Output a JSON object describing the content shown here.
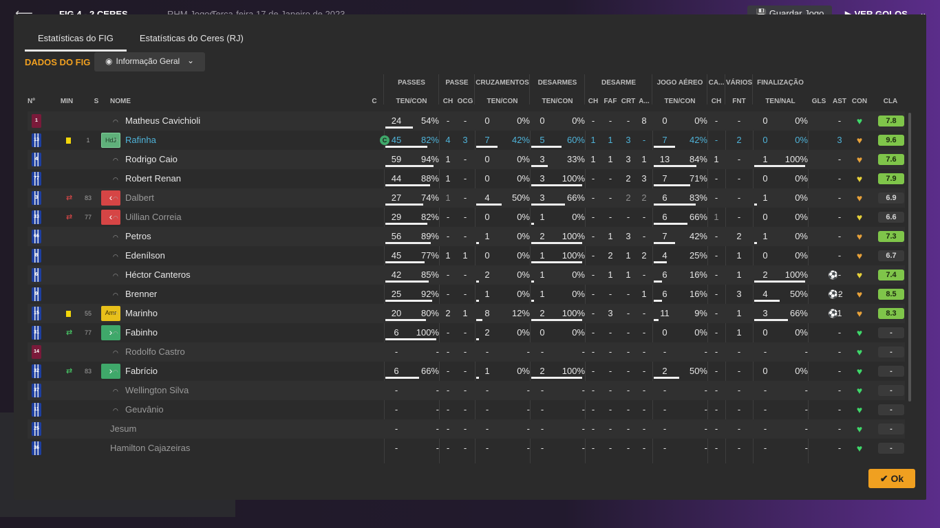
{
  "background": {
    "score": "FIG   4 - 2   CERES",
    "competition": "RHM Jogos",
    "date": "Terça-feira 17 de Janeiro de 2023",
    "save_label": "Guardar Jogo",
    "goals_label": "VER GOLOS"
  },
  "tabs": [
    {
      "label": "Estatísticas do FIG"
    },
    {
      "label": "Estatísticas do Ceres (RJ)"
    }
  ],
  "section_title": "DADOS DO FIG",
  "view_selector": "Informação Geral",
  "group_headers": {
    "passes": "PASSES",
    "passe": "PASSE",
    "cruzamentos": "CRUZAMENTOS",
    "desarmes": "DESARMES",
    "desarme": "DESARME",
    "jogo_aereo": "JOGO AÉREO",
    "cartoes": "CA...",
    "varios": "VÁRIOS",
    "finalizacao": "FINALIZAÇÃO"
  },
  "col_headers": {
    "no": "Nº",
    "min": "MIN",
    "s": "S",
    "nome": "NOME",
    "c": "C",
    "pass_tc": "TEN/CON",
    "passe_ch": "CH",
    "passe_ocg": "OCG",
    "cruz_tc": "TEN/CON",
    "des_tc": "TEN/CON",
    "d_ch": "CH",
    "d_faf": "FAF",
    "d_crt": "CRT",
    "d_a": "A...",
    "aer_tc": "TEN/CON",
    "cart_ch": "CH",
    "var_fnt": "FNT",
    "fin_tn": "TEN/NAL",
    "gls": "GLS",
    "ast": "AST",
    "con": "CON",
    "cla": "CLA"
  },
  "players": [
    {
      "num": "1",
      "gk": true,
      "name": "Matheus Cavichioli",
      "pass": [
        "24",
        "54%"
      ],
      "ch": "-",
      "ocg": "-",
      "cruz": [
        "0",
        "0%"
      ],
      "des": [
        "0",
        "0%"
      ],
      "dch": "-",
      "faf": "-",
      "crt": "-",
      "a": "8",
      "aer": [
        "0",
        "0%"
      ],
      "cart": "-",
      "fnt": "-",
      "fin": [
        "0",
        "0%"
      ],
      "gls": "",
      "ast": "-",
      "rating": "7.8",
      "cla_green": true,
      "heart": "green"
    },
    {
      "num": "13",
      "yellow": true,
      "min": "1",
      "pos": "HdJ",
      "posType": "hdl",
      "cap": "C",
      "name": "Rafinha",
      "nameClass": "blue",
      "pass": [
        "45",
        "82%"
      ],
      "ch": "4",
      "ocg": "3",
      "blue": true,
      "cruz": [
        "7",
        "42%"
      ],
      "des": [
        "5",
        "60%"
      ],
      "dch": "1",
      "faf": "1",
      "crt": "3",
      "a": "-",
      "aer": [
        "7",
        "42%"
      ],
      "cart": "-",
      "fnt": "2",
      "fin": [
        "0",
        "0%"
      ],
      "gls": "",
      "ast": "3",
      "rating": "9.6",
      "cla_green": true,
      "heart": "orange"
    },
    {
      "num": "4",
      "name": "Rodrigo Caio",
      "pass": [
        "59",
        "94%"
      ],
      "ch": "1",
      "ocg": "-",
      "cruz": [
        "0",
        "0%"
      ],
      "des": [
        "3",
        "33%"
      ],
      "dch": "1",
      "faf": "1",
      "crt": "3",
      "a": "1",
      "aer": [
        "13",
        "84%"
      ],
      "cart": "1",
      "fnt": "-",
      "fin": [
        "1",
        "100%"
      ],
      "gls": "",
      "ast": "-",
      "rating": "7.6",
      "cla_green": true,
      "heart": "orange"
    },
    {
      "num": "77",
      "name": "Robert Renan",
      "pass": [
        "44",
        "88%"
      ],
      "ch": "1",
      "ocg": "-",
      "cruz": [
        "0",
        "0%"
      ],
      "des": [
        "3",
        "100%"
      ],
      "dch": "-",
      "faf": "-",
      "crt": "2",
      "a": "3",
      "aer": [
        "7",
        "71%"
      ],
      "cart": "-",
      "fnt": "-",
      "fin": [
        "0",
        "0%"
      ],
      "gls": "",
      "ast": "-",
      "rating": "7.9",
      "cla_green": true,
      "heart": "yellow"
    },
    {
      "num": "3",
      "sub": "out",
      "min": "83",
      "pos": "‹",
      "posType": "out",
      "name": "Dalbert",
      "nameClass": "dim",
      "pass": [
        "27",
        "74%"
      ],
      "ch": "1",
      "ocg": "-",
      "cruz": [
        "4",
        "50%"
      ],
      "des": [
        "3",
        "66%"
      ],
      "dch": "-",
      "faf": "-",
      "crt": "2",
      "a": "2",
      "aer": [
        "6",
        "83%"
      ],
      "cart": "-",
      "fnt": "-",
      "fin": [
        "1",
        "0%"
      ],
      "gls": "",
      "ast": "-",
      "rating": "6.9",
      "cla_green": false,
      "heart": "orange"
    },
    {
      "num": "33",
      "sub": "out",
      "min": "77",
      "pos": "‹",
      "posType": "out",
      "name": "Uillian Correia",
      "nameClass": "dim",
      "pass": [
        "29",
        "82%"
      ],
      "ch": "-",
      "ocg": "-",
      "cruz": [
        "0",
        "0%"
      ],
      "des": [
        "1",
        "0%"
      ],
      "dch": "-",
      "faf": "-",
      "crt": "-",
      "a": "-",
      "aer": [
        "6",
        "66%"
      ],
      "cart": "1",
      "fnt": "-",
      "fin": [
        "0",
        "0%"
      ],
      "gls": "",
      "ast": "-",
      "rating": "6.6",
      "cla_green": false,
      "heart": "yellow"
    },
    {
      "num": "66",
      "name": "Petros",
      "pass": [
        "56",
        "89%"
      ],
      "ch": "-",
      "ocg": "-",
      "cruz": [
        "1",
        "0%"
      ],
      "des": [
        "2",
        "100%"
      ],
      "dch": "-",
      "faf": "1",
      "crt": "3",
      "a": "-",
      "aer": [
        "7",
        "42%"
      ],
      "cart": "-",
      "fnt": "2",
      "fin": [
        "1",
        "0%"
      ],
      "gls": "",
      "ast": "-",
      "rating": "7.3",
      "cla_green": true,
      "heart": "orange"
    },
    {
      "num": "8",
      "name": "Edenílson",
      "pass": [
        "45",
        "77%"
      ],
      "ch": "1",
      "ocg": "1",
      "cruz": [
        "0",
        "0%"
      ],
      "des": [
        "1",
        "100%"
      ],
      "dch": "-",
      "faf": "2",
      "crt": "1",
      "a": "2",
      "aer": [
        "4",
        "25%"
      ],
      "cart": "-",
      "fnt": "1",
      "fin": [
        "0",
        "0%"
      ],
      "gls": "",
      "ast": "-",
      "rating": "6.7",
      "cla_green": false,
      "heart": "orange"
    },
    {
      "num": "6",
      "name": "Héctor Canteros",
      "pass": [
        "42",
        "85%"
      ],
      "ch": "-",
      "ocg": "-",
      "cruz": [
        "2",
        "0%"
      ],
      "des": [
        "1",
        "0%"
      ],
      "dch": "-",
      "faf": "1",
      "crt": "1",
      "a": "-",
      "aer": [
        "6",
        "16%"
      ],
      "cart": "-",
      "fnt": "1",
      "fin": [
        "2",
        "100%"
      ],
      "gls": "⚽",
      "ast": "-",
      "rating": "7.4",
      "cla_green": true,
      "heart": "yellow"
    },
    {
      "num": "9",
      "name": "Brenner",
      "pass": [
        "25",
        "92%"
      ],
      "ch": "-",
      "ocg": "-",
      "cruz": [
        "1",
        "0%"
      ],
      "des": [
        "1",
        "0%"
      ],
      "dch": "-",
      "faf": "-",
      "crt": "-",
      "a": "1",
      "aer": [
        "6",
        "16%"
      ],
      "cart": "-",
      "fnt": "3",
      "fin": [
        "4",
        "50%"
      ],
      "gls": "⚽2",
      "ast": "-",
      "rating": "8.5",
      "cla_green": true,
      "heart": "orange"
    },
    {
      "num": "15",
      "yellow": true,
      "min": "55",
      "pos": "Amr",
      "posType": "amr",
      "name": "Marinho",
      "pass": [
        "20",
        "80%"
      ],
      "ch": "2",
      "ocg": "1",
      "cruz": [
        "8",
        "12%"
      ],
      "des": [
        "2",
        "100%"
      ],
      "dch": "-",
      "faf": "3",
      "crt": "-",
      "a": "-",
      "aer": [
        "11",
        "9%"
      ],
      "cart": "-",
      "fnt": "1",
      "fin": [
        "3",
        "66%"
      ],
      "gls": "⚽",
      "ast": "1",
      "rating": "8.3",
      "cla_green": true,
      "heart": "orange"
    },
    {
      "num": "31",
      "sub": "in",
      "min": "77",
      "pos": "›",
      "posType": "in",
      "name": "Fabinho",
      "pass": [
        "6",
        "100%"
      ],
      "ch": "-",
      "ocg": "-",
      "cruz": [
        "2",
        "0%"
      ],
      "des": [
        "0",
        "0%"
      ],
      "dch": "-",
      "faf": "-",
      "crt": "-",
      "a": "-",
      "aer": [
        "0",
        "0%"
      ],
      "cart": "-",
      "fnt": "1",
      "fin": [
        "0",
        "0%"
      ],
      "gls": "",
      "ast": "-",
      "rating": "-",
      "cla_green": false,
      "heart": "green"
    },
    {
      "num": "14",
      "gk": true,
      "name": "Rodolfo Castro",
      "nameClass": "dim",
      "pass": [
        "-",
        "-"
      ],
      "ch": "-",
      "ocg": "-",
      "cruz": [
        "-",
        "-"
      ],
      "des": [
        "-",
        "-"
      ],
      "dch": "-",
      "faf": "-",
      "crt": "-",
      "a": "-",
      "aer": [
        "-",
        "-"
      ],
      "cart": "-",
      "fnt": "-",
      "fin": [
        "-",
        "-"
      ],
      "gls": "",
      "ast": "-",
      "rating": "-",
      "cla_green": false,
      "heart": "green"
    },
    {
      "num": "32",
      "sub": "in",
      "min": "83",
      "pos": "›",
      "posType": "in",
      "name": "Fabrício",
      "pass": [
        "6",
        "66%"
      ],
      "ch": "-",
      "ocg": "-",
      "cruz": [
        "1",
        "0%"
      ],
      "des": [
        "2",
        "100%"
      ],
      "dch": "-",
      "faf": "-",
      "crt": "-",
      "a": "-",
      "aer": [
        "2",
        "50%"
      ],
      "cart": "-",
      "fnt": "-",
      "fin": [
        "0",
        "0%"
      ],
      "gls": "",
      "ast": "-",
      "rating": "-",
      "cla_green": false,
      "heart": "green"
    },
    {
      "num": "37",
      "name": "Wellington Silva",
      "nameClass": "dim",
      "pass": [
        "-",
        "-"
      ],
      "ch": "-",
      "ocg": "-",
      "cruz": [
        "-",
        "-"
      ],
      "des": [
        "-",
        "-"
      ],
      "dch": "-",
      "faf": "-",
      "crt": "-",
      "a": "-",
      "aer": [
        "-",
        "-"
      ],
      "cart": "-",
      "fnt": "-",
      "fin": [
        "-",
        "-"
      ],
      "gls": "",
      "ast": "-",
      "rating": "-",
      "cla_green": false,
      "heart": "green"
    },
    {
      "num": "11",
      "name": "Geuvânio",
      "nameClass": "dim",
      "pass": [
        "-",
        "-"
      ],
      "ch": "-",
      "ocg": "-",
      "cruz": [
        "-",
        "-"
      ],
      "des": [
        "-",
        "-"
      ],
      "dch": "-",
      "faf": "-",
      "crt": "-",
      "a": "-",
      "aer": [
        "-",
        "-"
      ],
      "cart": "-",
      "fnt": "-",
      "fin": [
        "-",
        "-"
      ],
      "gls": "",
      "ast": "-",
      "rating": "-",
      "cla_green": false,
      "heart": "green"
    },
    {
      "num": "25",
      "noHead": true,
      "name": "Jesum",
      "nameClass": "dim",
      "pass": [
        "-",
        "-"
      ],
      "ch": "-",
      "ocg": "-",
      "cruz": [
        "-",
        "-"
      ],
      "des": [
        "-",
        "-"
      ],
      "dch": "-",
      "faf": "-",
      "crt": "-",
      "a": "-",
      "aer": [
        "-",
        "-"
      ],
      "cart": "-",
      "fnt": "-",
      "fin": [
        "-",
        "-"
      ],
      "gls": "",
      "ast": "-",
      "rating": "-",
      "cla_green": false,
      "heart": "green"
    },
    {
      "num": "36",
      "noHead": true,
      "name": "Hamilton Cajazeiras",
      "nameClass": "dim",
      "pass": [
        "-",
        "-"
      ],
      "ch": "-",
      "ocg": "-",
      "cruz": [
        "-",
        "-"
      ],
      "des": [
        "-",
        "-"
      ],
      "dch": "-",
      "faf": "-",
      "crt": "-",
      "a": "-",
      "aer": [
        "-",
        "-"
      ],
      "cart": "-",
      "fnt": "-",
      "fin": [
        "-",
        "-"
      ],
      "gls": "",
      "ast": "-",
      "rating": "-",
      "cla_green": false,
      "heart": "green"
    }
  ],
  "ok_label": "Ok",
  "colors": {
    "accent": "#f0a020",
    "green": "#7fc54a",
    "blue_text": "#4fb3d9"
  }
}
